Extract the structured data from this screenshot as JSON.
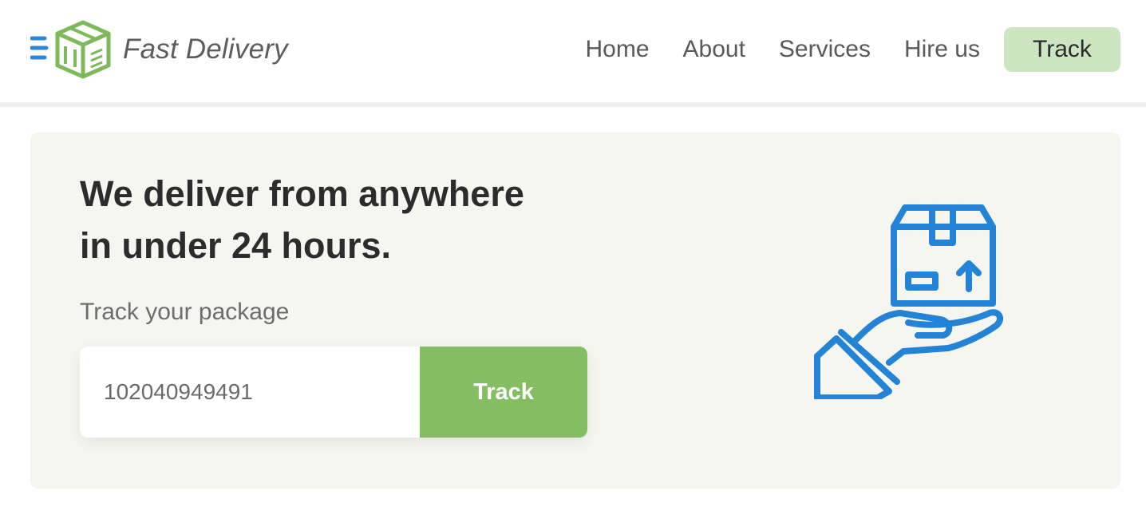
{
  "brand": {
    "name": "Fast Delivery",
    "logo_icon": "box-logo-icon",
    "logo_color": "#7db95a",
    "speed_lines_color": "#2f86d6"
  },
  "nav": {
    "links": [
      "Home",
      "About",
      "Services",
      "Hire us"
    ],
    "track_label": "Track",
    "track_bg": "#cde6c1"
  },
  "hero": {
    "title_line1": "We deliver from anywhere",
    "title_line2": "in under 24 hours.",
    "track_label": "Track your package",
    "input_value": "102040949491",
    "button_label": "Track",
    "button_color": "#85bd63",
    "background": "#f4f6ef",
    "illustration_icon": "hand-holding-package-icon",
    "illustration_color": "#2383d6"
  }
}
